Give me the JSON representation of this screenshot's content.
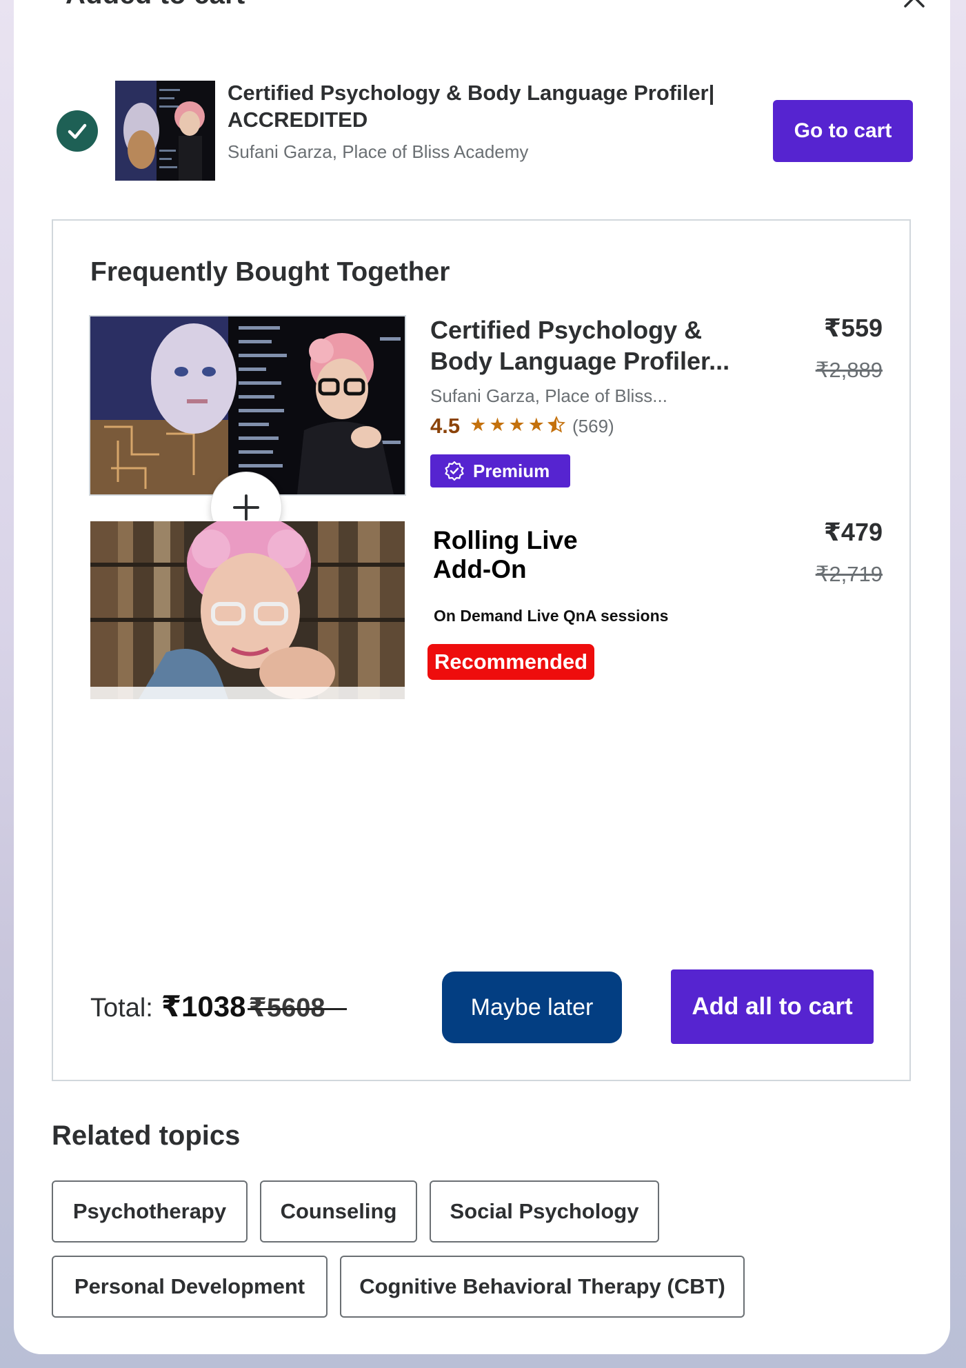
{
  "modal": {
    "title": "Added to cart",
    "close_icon": "close-icon"
  },
  "added_course": {
    "title_line1": "Certified Psychology & Body Language Profiler|",
    "title_line2": "ACCREDITED",
    "author": "Sufani Garza, Place of Bliss Academy",
    "go_to_cart_label": "Go to cart",
    "status_icon": "check-circle-icon"
  },
  "fbt": {
    "title": "Frequently Bought Together",
    "course1": {
      "title_line1": "Certified Psychology &",
      "title_line2": "Body Language Profiler...",
      "author": "Sufani Garza, Place of Bliss...",
      "rating": "4.5",
      "rating_value": 4.5,
      "rating_count": "(569)",
      "badge": "Premium",
      "price": "₹559",
      "old_price": "₹2,889"
    },
    "course2": {
      "title_line1": "Rolling Live",
      "title_line2": "Add-On",
      "description": "On Demand Live QnA sessions",
      "badge": "Recommended",
      "price": "₹479",
      "old_price": "₹2,719"
    },
    "plus_icon": "plus-icon",
    "total_label": "Total:",
    "total_price": "₹1038",
    "total_old_price": "₹5608",
    "maybe_later_label": "Maybe later",
    "add_all_label": "Add all to cart"
  },
  "related": {
    "title": "Related topics",
    "topics": [
      "Psychotherapy",
      "Counseling",
      "Social Psychology",
      "Personal Development",
      "Cognitive Behavioral Therapy (CBT)"
    ]
  },
  "colors": {
    "brand_purple": "#5624d0",
    "dark_blue": "#033e82",
    "success_green": "#1e6055",
    "recommended_red": "#ee0d0d",
    "star_orange": "#c4710d"
  }
}
